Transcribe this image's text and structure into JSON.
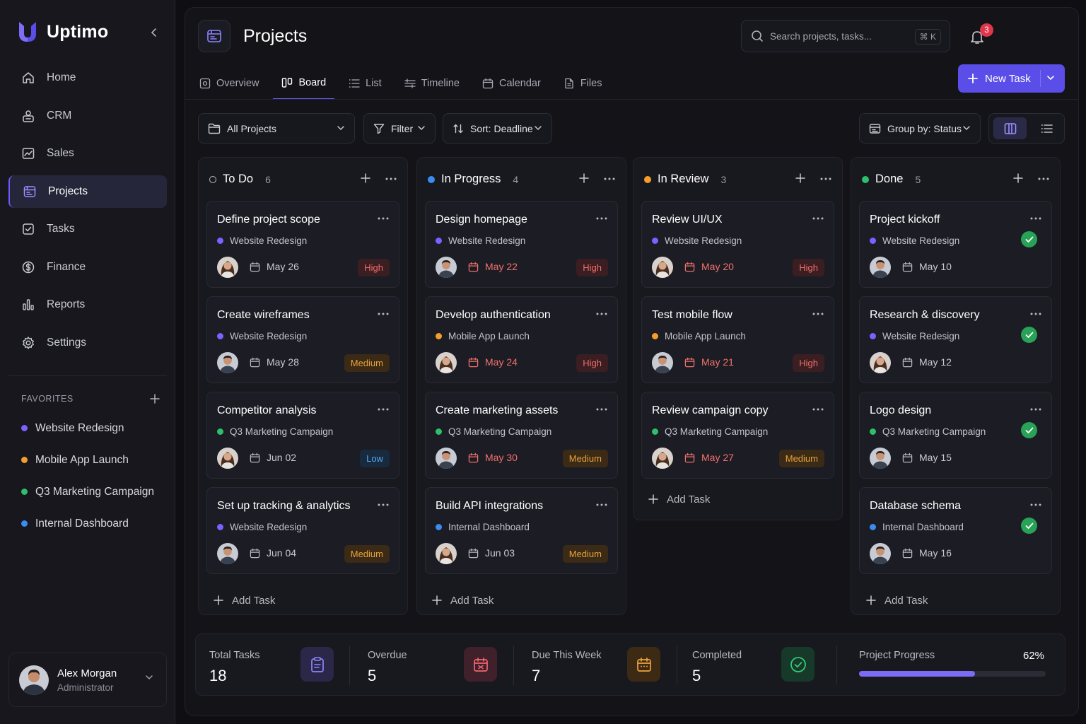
{
  "brand": {
    "name": "Uptimo"
  },
  "nav": [
    {
      "label": "Home",
      "icon": "home-icon"
    },
    {
      "label": "CRM",
      "icon": "crm-icon"
    },
    {
      "label": "Sales",
      "icon": "sales-chart-icon"
    },
    {
      "label": "Projects",
      "icon": "projects-icon",
      "active": true
    },
    {
      "label": "Tasks",
      "icon": "tasks-checkbox-icon"
    },
    {
      "label": "Finance",
      "icon": "dollar-icon"
    },
    {
      "label": "Reports",
      "icon": "bar-chart-icon"
    },
    {
      "label": "Settings",
      "icon": "gear-icon"
    }
  ],
  "favorites": {
    "title": "FAVORITES",
    "items": [
      {
        "label": "Website Redesign",
        "color": "#7b61ff"
      },
      {
        "label": "Mobile App Launch",
        "color": "#f59e2b"
      },
      {
        "label": "Q3 Marketing Campaign",
        "color": "#2fbf6c"
      },
      {
        "label": "Internal Dashboard",
        "color": "#3b8cf0"
      }
    ]
  },
  "user": {
    "name": "Alex Morgan",
    "role": "Administrator"
  },
  "header": {
    "title": "Projects",
    "search_placeholder": "Search projects, tasks...",
    "search_shortcut": "⌘ K",
    "notification_count": "3",
    "new_task_label": "New Task"
  },
  "tabs": [
    {
      "label": "Overview",
      "icon": "overview-icon"
    },
    {
      "label": "Board",
      "icon": "board-icon",
      "active": true
    },
    {
      "label": "List",
      "icon": "list-icon"
    },
    {
      "label": "Timeline",
      "icon": "timeline-icon"
    },
    {
      "label": "Calendar",
      "icon": "calendar-icon"
    },
    {
      "label": "Files",
      "icon": "file-icon"
    }
  ],
  "toolbar": {
    "project_select": "All Projects",
    "filter": "Filter",
    "sort": "Sort: Deadline",
    "group_by": "Group by: Status",
    "view_mode": "board"
  },
  "colors": {
    "accent": "#5b4ee8",
    "website_redesign": "#7b61ff",
    "mobile_app_launch": "#f59e2b",
    "q3_marketing": "#2fbf6c",
    "internal_dashboard": "#3b8cf0",
    "in_progress": "#3b8cf0",
    "in_review": "#f59e2b",
    "done": "#2fbf6c"
  },
  "columns": [
    {
      "title": "To Do",
      "count": "6",
      "status": "todo",
      "add_label": "Add Task",
      "cards": [
        {
          "title": "Define project scope",
          "project": "Website Redesign",
          "project_color": "#7b61ff",
          "date": "May 26",
          "priority": "High",
          "avatar": "female",
          "date_overdue": false
        },
        {
          "title": "Create wireframes",
          "project": "Website Redesign",
          "project_color": "#7b61ff",
          "date": "May 28",
          "priority": "Medium",
          "avatar": "male",
          "date_overdue": false
        },
        {
          "title": "Competitor analysis",
          "project": "Q3 Marketing Campaign",
          "project_color": "#2fbf6c",
          "date": "Jun 02",
          "priority": "Low",
          "avatar": "female",
          "date_overdue": false
        },
        {
          "title": "Set up tracking & analytics",
          "project": "Website Redesign",
          "project_color": "#7b61ff",
          "date": "Jun 04",
          "priority": "Medium",
          "avatar": "male",
          "date_overdue": false
        }
      ]
    },
    {
      "title": "In Progress",
      "count": "4",
      "status": "progress",
      "add_label": "Add Task",
      "cards": [
        {
          "title": "Design homepage",
          "project": "Website Redesign",
          "project_color": "#7b61ff",
          "date": "May 22",
          "priority": "High",
          "avatar": "male",
          "date_overdue": true
        },
        {
          "title": "Develop authentication",
          "project": "Mobile App Launch",
          "project_color": "#f59e2b",
          "date": "May 24",
          "priority": "High",
          "avatar": "female",
          "date_overdue": true
        },
        {
          "title": "Create marketing assets",
          "project": "Q3 Marketing Campaign",
          "project_color": "#2fbf6c",
          "date": "May 30",
          "priority": "Medium",
          "avatar": "male",
          "date_overdue": true
        },
        {
          "title": "Build API integrations",
          "project": "Internal Dashboard",
          "project_color": "#3b8cf0",
          "date": "Jun 03",
          "priority": "Medium",
          "avatar": "female",
          "date_overdue": false
        }
      ]
    },
    {
      "title": "In Review",
      "count": "3",
      "status": "review",
      "add_label": "Add Task",
      "cards": [
        {
          "title": "Review UI/UX",
          "project": "Website Redesign",
          "project_color": "#7b61ff",
          "date": "May 20",
          "priority": "High",
          "avatar": "female",
          "date_overdue": true
        },
        {
          "title": "Test mobile flow",
          "project": "Mobile App Launch",
          "project_color": "#f59e2b",
          "date": "May 21",
          "priority": "High",
          "avatar": "male",
          "date_overdue": true
        },
        {
          "title": "Review campaign copy",
          "project": "Q3 Marketing Campaign",
          "project_color": "#2fbf6c",
          "date": "May 27",
          "priority": "Medium",
          "avatar": "female",
          "date_overdue": true
        }
      ]
    },
    {
      "title": "Done",
      "count": "5",
      "status": "done",
      "add_label": "Add Task",
      "cards": [
        {
          "title": "Project kickoff",
          "project": "Website Redesign",
          "project_color": "#7b61ff",
          "date": "May 10",
          "priority": "",
          "avatar": "male",
          "date_overdue": false
        },
        {
          "title": "Research & discovery",
          "project": "Website Redesign",
          "project_color": "#7b61ff",
          "date": "May 12",
          "priority": "",
          "avatar": "female",
          "date_overdue": false
        },
        {
          "title": "Logo design",
          "project": "Q3 Marketing Campaign",
          "project_color": "#2fbf6c",
          "date": "May 15",
          "priority": "",
          "avatar": "male",
          "date_overdue": false
        },
        {
          "title": "Database schema",
          "project": "Internal Dashboard",
          "project_color": "#3b8cf0",
          "date": "May 16",
          "priority": "",
          "avatar": "male",
          "date_overdue": false
        }
      ]
    }
  ],
  "stats": {
    "total": {
      "label": "Total Tasks",
      "value": "18",
      "icon": "clipboard-icon"
    },
    "overdue": {
      "label": "Overdue",
      "value": "5",
      "icon": "calendar-alert-icon"
    },
    "due_week": {
      "label": "Due This Week",
      "value": "7",
      "icon": "calendar-week-icon"
    },
    "completed": {
      "label": "Completed",
      "value": "5",
      "icon": "check-circle-icon"
    },
    "progress": {
      "label": "Project Progress",
      "value": "62%",
      "fraction": 0.62
    }
  }
}
